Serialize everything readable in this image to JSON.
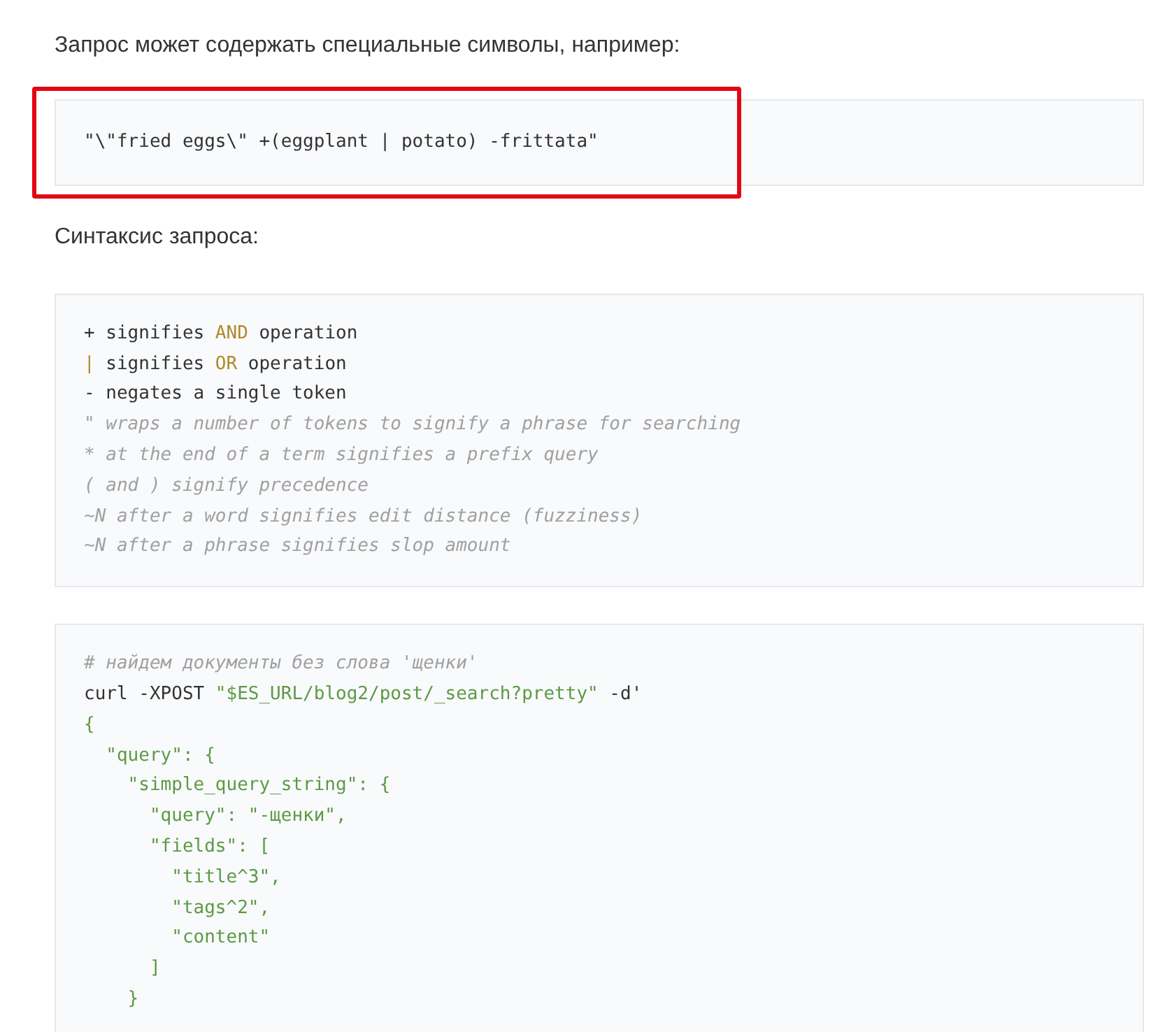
{
  "content": [
    {
      "kind": "paragraph",
      "text": "Запрос может содержать специальные символы, например:"
    },
    {
      "kind": "code",
      "highlighted": true,
      "lines": [
        [
          {
            "kind": "plain",
            "text": "\"\\\"fried eggs\\\" +(eggplant | potato) -frittata\""
          }
        ]
      ]
    },
    {
      "kind": "paragraph",
      "text": "Синтаксис запроса:"
    },
    {
      "kind": "code",
      "highlighted": false,
      "lines": [
        [
          {
            "kind": "plain",
            "text": "+ signifies "
          },
          {
            "kind": "keyword",
            "text": "AND"
          },
          {
            "kind": "plain",
            "text": " operation"
          }
        ],
        [
          {
            "kind": "keyword",
            "text": "|"
          },
          {
            "kind": "plain",
            "text": " signifies "
          },
          {
            "kind": "keyword",
            "text": "OR"
          },
          {
            "kind": "plain",
            "text": " operation"
          }
        ],
        [
          {
            "kind": "plain",
            "text": "- negates a single token"
          }
        ],
        [
          {
            "kind": "comment",
            "text": "\" wraps a number of tokens to signify a phrase for searching"
          }
        ],
        [
          {
            "kind": "comment",
            "text": "* at the end of a term signifies a prefix query"
          }
        ],
        [
          {
            "kind": "comment",
            "text": "( and ) signify precedence"
          }
        ],
        [
          {
            "kind": "comment",
            "text": "~N after a word signifies edit distance (fuzziness)"
          }
        ],
        [
          {
            "kind": "comment",
            "text": "~N after a phrase signifies slop amount"
          }
        ]
      ]
    },
    {
      "kind": "code",
      "highlighted": false,
      "lines": [
        [
          {
            "kind": "comment",
            "text": "# найдем документы без слова 'щенки'"
          }
        ],
        [
          {
            "kind": "plain",
            "text": "curl -XPOST "
          },
          {
            "kind": "string",
            "text": "\"$ES_URL/blog2/post/_search?pretty\""
          },
          {
            "kind": "plain",
            "text": " -d'"
          }
        ],
        [
          {
            "kind": "string",
            "text": "{"
          }
        ],
        [
          {
            "kind": "string",
            "text": "  \"query\": {"
          }
        ],
        [
          {
            "kind": "string",
            "text": "    \"simple_query_string\": {"
          }
        ],
        [
          {
            "kind": "string",
            "text": "      \"query\": \"-щенки\","
          }
        ],
        [
          {
            "kind": "string",
            "text": "      \"fields\": ["
          }
        ],
        [
          {
            "kind": "string",
            "text": "        \"title^3\","
          }
        ],
        [
          {
            "kind": "string",
            "text": "        \"tags^2\","
          }
        ],
        [
          {
            "kind": "string",
            "text": "        \"content\""
          }
        ],
        [
          {
            "kind": "string",
            "text": "      ]"
          }
        ],
        [
          {
            "kind": "string",
            "text": "    }"
          }
        ]
      ]
    }
  ]
}
